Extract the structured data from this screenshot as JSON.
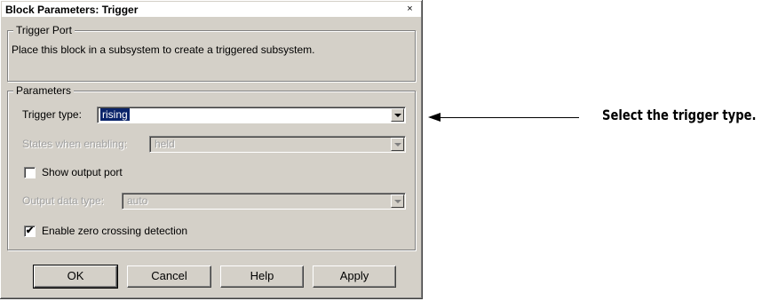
{
  "dialog": {
    "title": "Block Parameters: Trigger",
    "close_glyph": "×"
  },
  "trigger_port": {
    "legend": "Trigger Port",
    "description": "Place this block in a subsystem to create a triggered subsystem."
  },
  "parameters": {
    "legend": "Parameters",
    "trigger_type": {
      "label": "Trigger type:",
      "value": "rising"
    },
    "states_when_enabling": {
      "label": "States when enabling:",
      "value": "held",
      "enabled": false
    },
    "show_output_port": {
      "label": "Show output port",
      "checked": false
    },
    "output_data_type": {
      "label": "Output data type:",
      "value": "auto",
      "enabled": false
    },
    "enable_zero_crossing": {
      "label": "Enable zero crossing detection",
      "checked": true,
      "check_glyph": "✔"
    }
  },
  "buttons": {
    "ok": "OK",
    "cancel": "Cancel",
    "help": "Help",
    "apply": "Apply"
  },
  "annotation": {
    "text": "Select the trigger type."
  }
}
